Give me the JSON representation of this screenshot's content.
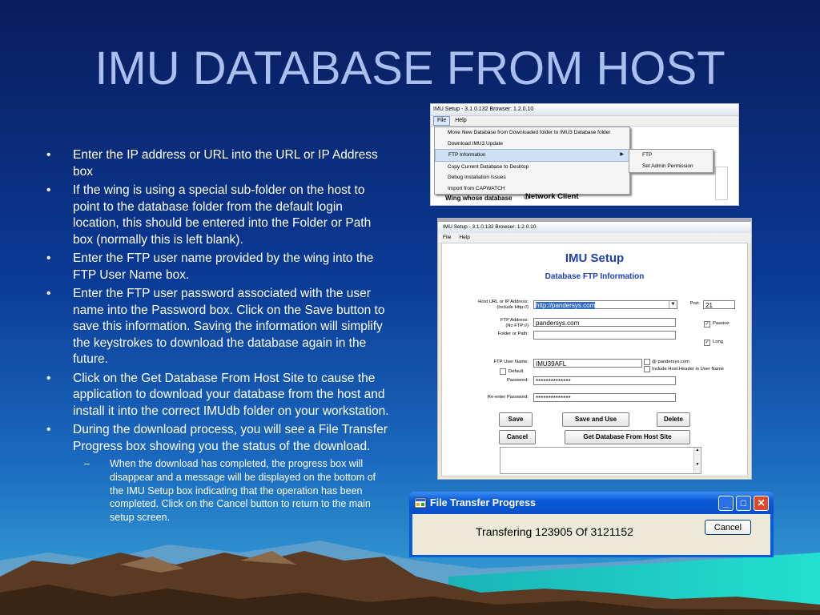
{
  "slide": {
    "title": "IMU DATABASE FROM HOST",
    "bullets": [
      "Enter the IP address or URL into the URL or IP Address box",
      "If the wing is using a special sub-folder on the host to point to the database folder from the default login location, this should be entered into the Folder or Path box (normally this is left blank).",
      "Enter the FTP user name provided by the wing into the FTP User Name box.",
      "Enter the FTP user password associated with the user name into the Password box. Click on the Save button to save this information. Saving the information will simplify the keystrokes to download the database again in the future.",
      "Click on the Get Database From Host Site to cause the application to download your database from the host and install it into the correct IMUdb folder on your workstation.",
      "During the download process, you will see a File Transfer Progress box showing you the status of the download."
    ],
    "sub_bullet": "When the download has completed, the progress box will disappear and a message will be displayed on the bottom of the IMU Setup box indicating that the operation has been completed. Click on the Cancel button to return to the main setup screen."
  },
  "menu_screenshot": {
    "window_title": "IMU Setup - 3.1.0.132   Browser: 1.2.0.10",
    "menubar": [
      "File",
      "Help"
    ],
    "file_menu": [
      "Move New Database from Downloaded folder to IMU3 Database folder",
      "Download IMU3 Update",
      "FTP Information",
      "Copy Current Database to Desktop",
      "Debug Installation Issues",
      "Import from CAPWATCH"
    ],
    "submenu": [
      "FTP",
      "Set Admin Permission"
    ],
    "wing_label": "Wing whose database",
    "network_client": "Network Client"
  },
  "setup_screenshot": {
    "window_title": "IMU Setup - 3.1.0.132   Browser: 1.2.0.10",
    "menubar": [
      "File",
      "Help"
    ],
    "title": "IMU Setup",
    "subtitle": "Database FTP Information",
    "host_label": "Host URL or IP Address:\n(Include Http://)",
    "host_value": "http://pandersys.com",
    "port_label": "Port:",
    "port_value": "21",
    "ftp_label": "FTP Address:\n(No FTP://)",
    "ftp_value": "pandersys.com",
    "folder_label": "Folder or Path:",
    "passive_label": "Passive",
    "long_label": "Long",
    "user_label": "FTP User Name:",
    "user_value": "IMU39AFL",
    "default_label": "Default",
    "at_label": "@ pandersys.com",
    "include_label": "Include Host Header in User Name",
    "password_label": "Password:",
    "password_value": "**************",
    "reenter_label": "Re-enter Password:",
    "reenter_value": "**************",
    "buttons": {
      "save": "Save",
      "save_use": "Save and Use",
      "delete": "Delete",
      "cancel": "Cancel",
      "get_db": "Get Database From Host Site"
    }
  },
  "progress_dialog": {
    "title": "File Transfer Progress",
    "message": "Transfering 123905 Of 3121152",
    "cancel": "Cancel"
  }
}
